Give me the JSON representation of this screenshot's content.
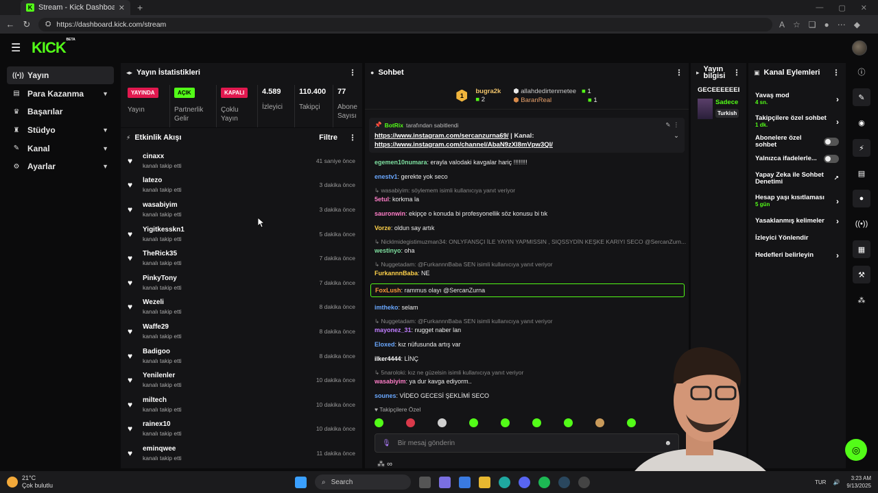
{
  "browser": {
    "tab_title": "Stream - Kick Dashboard",
    "url": "https://dashboard.kick.com/stream"
  },
  "app": {
    "logo": "KICK",
    "logo_tag": "BETA"
  },
  "sidebar": {
    "items": [
      {
        "label": "Yayın",
        "icon": "broadcast-icon",
        "active": true
      },
      {
        "label": "Para Kazanma",
        "icon": "money-icon",
        "chevron": true
      },
      {
        "label": "Başarılar",
        "icon": "trophy-icon"
      },
      {
        "label": "Stüdyo",
        "icon": "studio-icon",
        "chevron": true
      },
      {
        "label": "Kanal",
        "icon": "channel-icon",
        "chevron": true
      },
      {
        "label": "Ayarlar",
        "icon": "gear-icon",
        "chevron": true
      }
    ]
  },
  "stats": {
    "title": "Yayın İstatistikleri",
    "items": [
      {
        "badge": "YAYINDA",
        "badge_color": "#e1194f",
        "caption": "Yayın"
      },
      {
        "badge": "AÇIK",
        "badge_color": "#53fc18",
        "caption": "Partnerlik Gelir"
      },
      {
        "badge": "KAPALI",
        "badge_color": "#e1194f",
        "caption": "Çoklu Yayın"
      },
      {
        "value": "4.589",
        "caption": "İzleyici"
      },
      {
        "value": "110.400",
        "caption": "Takipçi"
      },
      {
        "value": "77",
        "caption": "Abone Sayısı"
      }
    ]
  },
  "activity": {
    "title": "Etkinlik Akışı",
    "filter_label": "Filtre",
    "items": [
      {
        "name": "cinaxx",
        "action": "kanalı takip etti",
        "time": "41 saniye önce"
      },
      {
        "name": "latezo",
        "action": "kanalı takip etti",
        "time": "3 dakika önce"
      },
      {
        "name": "wasabiyim",
        "action": "kanalı takip etti",
        "time": "3 dakika önce"
      },
      {
        "name": "Yigitkesskn1",
        "action": "kanalı takip etti",
        "time": "5 dakika önce"
      },
      {
        "name": "TheRick35",
        "action": "kanalı takip etti",
        "time": "7 dakika önce"
      },
      {
        "name": "PinkyTony",
        "action": "kanalı takip etti",
        "time": "7 dakika önce"
      },
      {
        "name": "Wezeli",
        "action": "kanalı takip etti",
        "time": "8 dakika önce"
      },
      {
        "name": "Waffe29",
        "action": "kanalı takip etti",
        "time": "8 dakika önce"
      },
      {
        "name": "Badigoo",
        "action": "kanalı takip etti",
        "time": "8 dakika önce"
      },
      {
        "name": "Yenilenler",
        "action": "kanalı takip etti",
        "time": "10 dakika önce"
      },
      {
        "name": "miltech",
        "action": "kanalı takip etti",
        "time": "10 dakika önce"
      },
      {
        "name": "rainex10",
        "action": "kanalı takip etti",
        "time": "10 dakika önce"
      },
      {
        "name": "eminqwee",
        "action": "kanalı takip etti",
        "time": "11 dakika önce"
      }
    ]
  },
  "chat": {
    "title": "Sohbet",
    "leaders": [
      {
        "rank": "1",
        "name": "bugra2k",
        "count": "2"
      },
      {
        "name": "allahdedirtenmetee",
        "count": "1"
      },
      {
        "name": "BaranReal",
        "count": "1"
      }
    ],
    "pinned": {
      "author": "BotRix",
      "suffix": "tarafından sabitlendi",
      "link1": "https://www.instagram.com/sercanzurna69/",
      "sep": " | Kanal:",
      "link2": "https://www.instagram.com/channel/AbaN9zXl8mVpw3QI/"
    },
    "messages": [
      {
        "type": "msg",
        "user": "egemen10numara",
        "color": "#7ee0a0",
        "text": ": erayla valodaki kavgalar hariç !!!!!!!!"
      },
      {
        "type": "msg",
        "user": "enestv1",
        "color": "#6aa8ff",
        "text": ": gerekte yok seco"
      },
      {
        "type": "reply",
        "text": "wasabiyim: söylemem isimli kullanıcıya yanıt veriyor"
      },
      {
        "type": "msg",
        "user": "5etul",
        "color": "#ff7ec8",
        "text": ": korkma la"
      },
      {
        "type": "msg",
        "user": "sauronwin",
        "color": "#ff7ec8",
        "text": ": ekipçe o konuda bi profesyonellik söz konusu bi tık"
      },
      {
        "type": "msg",
        "user": "Vorze",
        "color": "#ffd24a",
        "text": ": oldun say artık"
      },
      {
        "type": "reply",
        "text": "Nicklmidegistimuzman34: ONLYFANSÇI İLE YAYIN YAPMISSIN , SIQSSYDİN KEŞKE KARIYI SECO @SercanZurn..."
      },
      {
        "type": "msg",
        "user": "westinyo",
        "color": "#7ee0a0",
        "text": ": oha"
      },
      {
        "type": "reply",
        "text": "Nuggetadam: @FurkannnBaba SEN isimli kullanıcıya yanıt veriyor"
      },
      {
        "type": "msg",
        "user": "FurkannnBaba",
        "color": "#ffd24a",
        "text": ": NE"
      },
      {
        "type": "hl",
        "user": "FoxLush",
        "color": "#ff9a3c",
        "text": ": rammus olayı @SercanZurna"
      },
      {
        "type": "msg",
        "user": "imtheko",
        "color": "#6aa8ff",
        "text": ": selam"
      },
      {
        "type": "reply",
        "text": "Nuggetadam: @FurkannnBaba SEN isimli kullanıcıya yanıt veriyor"
      },
      {
        "type": "msg",
        "user": "mayonez_31",
        "color": "#c07eff",
        "text": ": nugget naber lan"
      },
      {
        "type": "msg",
        "user": "Eloxed",
        "color": "#6aa8ff",
        "text": ": kız nüfusunda artış var"
      },
      {
        "type": "msg",
        "user": "ilker4444",
        "color": "#ffffff",
        "text": ": LİNÇ"
      },
      {
        "type": "reply",
        "text": "5naroloki: kız ne güzelsin isimli kullanıcıya yanıt veriyor"
      },
      {
        "type": "msg",
        "user": "wasabiyim",
        "color": "#ff7ec8",
        "text": ": ya dur kavga ediyorm.."
      },
      {
        "type": "msg",
        "user": "sounes",
        "color": "#6aa8ff",
        "text": ": VİDEO GECESİ ŞEKLİMİ SECO"
      }
    ],
    "followers_only": "Takipçilere Özel",
    "input_placeholder": "Bir mesaj gönderin"
  },
  "stream_info": {
    "title": "Yayın bilgisi",
    "stream_title": "GECEEEEEEE",
    "category": "Sadece",
    "tag": "Turkish"
  },
  "channel_actions": {
    "title": "Kanal Eylemleri",
    "items": [
      {
        "label": "Yavaş mod",
        "sub": "4 sn.",
        "control": "chevron"
      },
      {
        "label": "Takipçilere özel sohbet",
        "sub": "1 dk.",
        "control": "chevron"
      },
      {
        "label": "Abonelere özel sohbet",
        "control": "toggle"
      },
      {
        "label": "Yalnızca ifadelerle...",
        "control": "toggle"
      },
      {
        "label": "Yapay Zeka ile Sohbet Denetimi",
        "control": "external"
      },
      {
        "label": "Hesap yaşı kısıtlaması",
        "sub": "5 gün",
        "control": "chevron"
      },
      {
        "label": "Yasaklanmış kelimeler",
        "control": "chevron"
      },
      {
        "label": "İzleyici Yönlendir",
        "control": "none"
      },
      {
        "label": "Hedefleri belirleyin",
        "control": "chevron"
      }
    ]
  },
  "taskbar": {
    "temp": "21°C",
    "weather": "Çok bulutlu",
    "search": "Search",
    "lang": "TUR",
    "time": "3:23 AM",
    "date": "9/13/2025"
  },
  "colors": {
    "accent": "#53fc18",
    "live": "#e1194f",
    "panel": "#141416"
  }
}
